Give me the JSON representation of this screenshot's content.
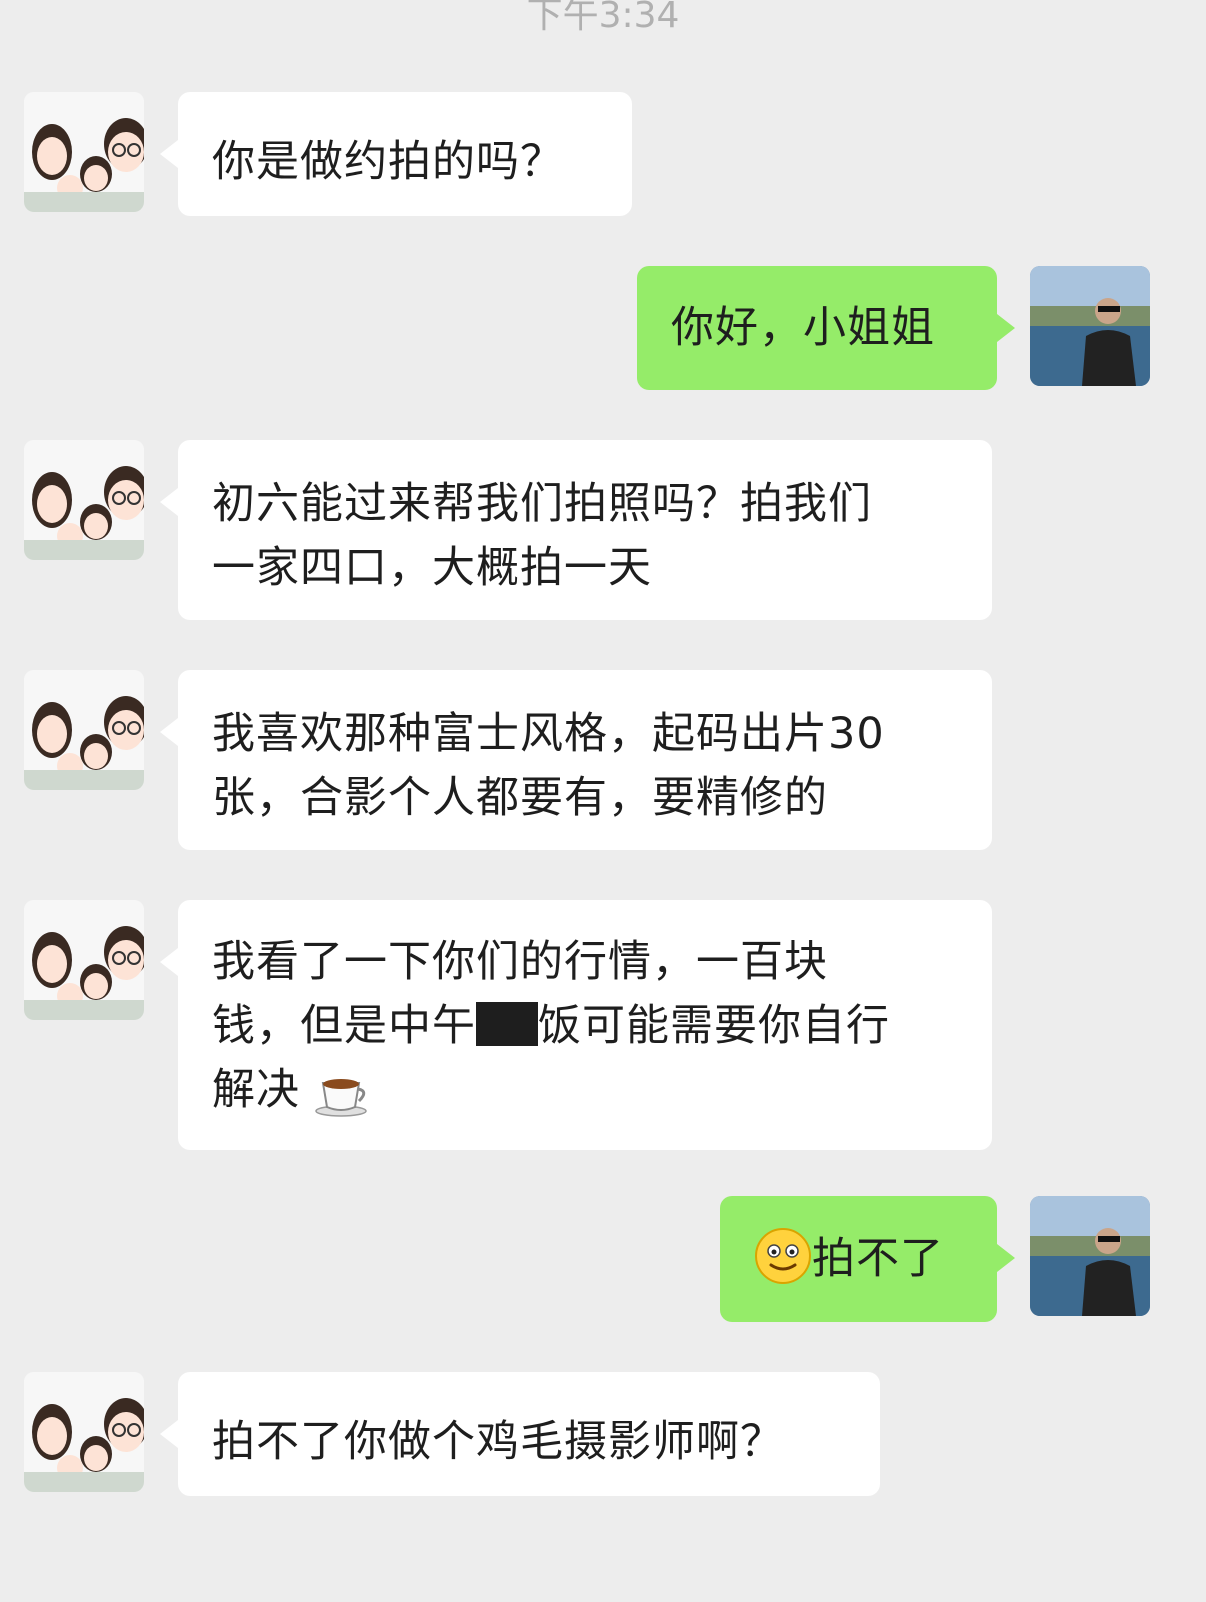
{
  "header": {
    "timestamp": "下午3:34"
  },
  "messages": [
    {
      "sender": "other",
      "text": "你是做约拍的吗？"
    },
    {
      "sender": "me",
      "text": "你好，小姐姐"
    },
    {
      "sender": "other",
      "lines": [
        "初六能过来帮我们拍照吗？拍我们",
        "一家四口，大概拍一天"
      ]
    },
    {
      "sender": "other",
      "lines": [
        "我喜欢那种富士风格，起码出片30",
        "张，合影个人都要有，要精修的"
      ]
    },
    {
      "sender": "other",
      "line1": "我看了一下你们的行情，一百块",
      "line2a": "钱，但是中午",
      "line2b": "饭可能需要你自行",
      "line3": "解决",
      "emoji": "coffee-icon"
    },
    {
      "sender": "me",
      "text": "拍不了",
      "emoji": "smiley-icon"
    },
    {
      "sender": "other",
      "text": "拍不了你做个鸡毛摄影师啊？"
    }
  ],
  "colors": {
    "background": "#ededed",
    "incoming_bubble": "#ffffff",
    "outgoing_bubble": "#95ec69"
  }
}
